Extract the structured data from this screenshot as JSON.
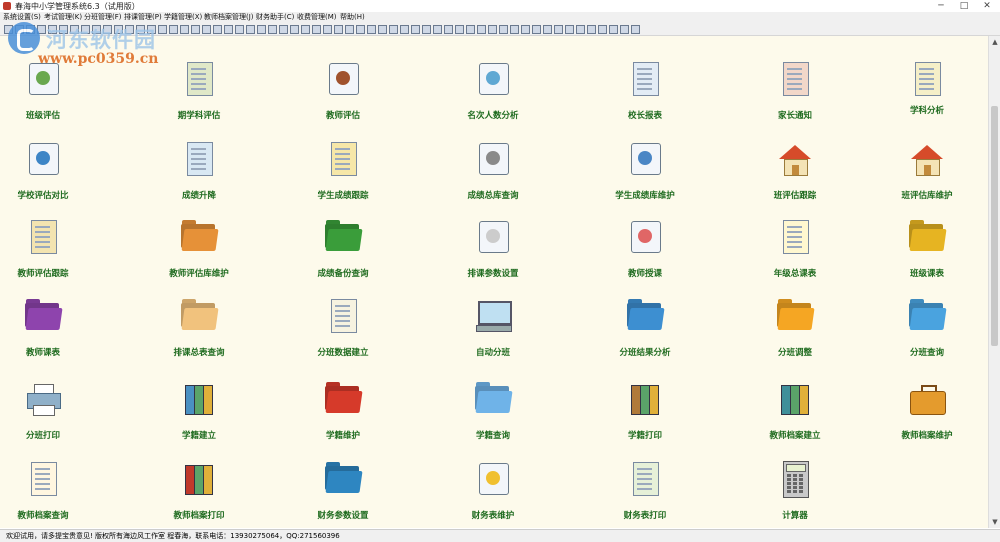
{
  "window": {
    "title": "春海中小学管理系统6.3（试用版）",
    "minimize": "─",
    "maximize": "□",
    "close": "✕"
  },
  "menu": [
    "系统设置(S)",
    "考试管理(K)",
    "分班管理(F)",
    "排课管理(P)",
    "学籍管理(X)",
    "教师档案管理(J)",
    "财务助手(C)",
    "收费管理(M)",
    "帮助(H)"
  ],
  "watermark": {
    "name": "河东软件园",
    "url": "www.pc0359.cn"
  },
  "tiles": [
    {
      "label": "班级评估",
      "icon": "bar-chart-icon",
      "kind": "generic",
      "color": "#6aa84f"
    },
    {
      "label": "期学科评估",
      "icon": "calendar-icon",
      "kind": "doc",
      "color": "#e0e8c8"
    },
    {
      "label": "教师评估",
      "icon": "teacher-photo-icon",
      "kind": "generic",
      "color": "#a0522d"
    },
    {
      "label": "名次人数分析",
      "icon": "open-book-icon",
      "kind": "generic",
      "color": "#5fa8d3"
    },
    {
      "label": "校长报表",
      "icon": "checklist-icon",
      "kind": "doc",
      "color": "#e3ecf5"
    },
    {
      "label": "家长通知",
      "icon": "ribbon-letter-icon",
      "kind": "doc",
      "color": "#f2d7c9"
    },
    {
      "label": "学科分析",
      "icon": "pencil-calendar-icon",
      "kind": "doc",
      "color": "#f5efc8"
    },
    {
      "label": "学校评估对比",
      "icon": "chart-compare-icon",
      "kind": "generic",
      "color": "#3d85c6"
    },
    {
      "label": "成绩升降",
      "icon": "clock-document-icon",
      "kind": "doc",
      "color": "#d9e8f3"
    },
    {
      "label": "学生成绩跟踪",
      "icon": "notepad-icon",
      "kind": "doc",
      "color": "#f6e7a8"
    },
    {
      "label": "成绩总库查询",
      "icon": "clock-calendar-icon",
      "kind": "generic",
      "color": "#8a8a8a"
    },
    {
      "label": "学生成绩库维护",
      "icon": "tile-windows-icon",
      "kind": "generic",
      "color": "#4a86c5"
    },
    {
      "label": "班评估跟踪",
      "icon": "house-icon",
      "kind": "house",
      "color": "#d64b2a"
    },
    {
      "label": "班评估库维护",
      "icon": "house-arrow-icon",
      "kind": "house",
      "color": "#d64b2a"
    },
    {
      "label": "教师评估跟踪",
      "icon": "document-arrow-icon",
      "kind": "doc",
      "color": "#f3e4b0"
    },
    {
      "label": "教师评估库维护",
      "icon": "orange-folder-icon",
      "kind": "folder",
      "color": "#e69138"
    },
    {
      "label": "成绩备份查询",
      "icon": "green-folder-icon",
      "kind": "folder",
      "color": "#3a9d3a"
    },
    {
      "label": "排课参数设置",
      "icon": "tablet-pen-icon",
      "kind": "generic",
      "color": "#cccccc"
    },
    {
      "label": "教师授课",
      "icon": "star-person-icon",
      "kind": "generic",
      "color": "#e06666"
    },
    {
      "label": "年级总课表",
      "icon": "notepad-lines-icon",
      "kind": "doc",
      "color": "#fff8d0"
    },
    {
      "label": "班级课表",
      "icon": "folder-binder-icon",
      "kind": "folder",
      "color": "#e6b422"
    },
    {
      "label": "教师课表",
      "icon": "purple-folder-icon",
      "kind": "folder",
      "color": "#8e44ad"
    },
    {
      "label": "排课总表查询",
      "icon": "open-folder-icon",
      "kind": "folder",
      "color": "#f1c27d"
    },
    {
      "label": "分班数据建立",
      "icon": "clipboard-person-icon",
      "kind": "doc",
      "color": "#f6f2e0"
    },
    {
      "label": "自动分班",
      "icon": "computer-icon",
      "kind": "monitor",
      "color": "#bfe0f2"
    },
    {
      "label": "分班结果分析",
      "icon": "blue-folder-disc-icon",
      "kind": "folder",
      "color": "#3d8fd1"
    },
    {
      "label": "分班调整",
      "icon": "yellow-folder-icon",
      "kind": "folder",
      "color": "#f5a623"
    },
    {
      "label": "分班查询",
      "icon": "blue-folder-icon",
      "kind": "folder",
      "color": "#4aa3df"
    },
    {
      "label": "分班打印",
      "icon": "printer-icon",
      "kind": "printer",
      "color": "#8fb0c9"
    },
    {
      "label": "学籍建立",
      "icon": "colored-binders-icon",
      "kind": "book",
      "color": "#4a90c2"
    },
    {
      "label": "学籍维护",
      "icon": "red-folder-icon",
      "kind": "folder",
      "color": "#d63a2a"
    },
    {
      "label": "学籍查询",
      "icon": "light-blue-folder-icon",
      "kind": "folder",
      "color": "#6fb3e8"
    },
    {
      "label": "学籍打印",
      "icon": "brown-binder-icon",
      "kind": "book",
      "color": "#b07a3a"
    },
    {
      "label": "教师档案建立",
      "icon": "teal-book-icon",
      "kind": "book",
      "color": "#3f8f9a"
    },
    {
      "label": "教师档案维护",
      "icon": "briefcase-icon",
      "kind": "case",
      "color": "#e49b2d"
    },
    {
      "label": "教师档案查询",
      "icon": "notepad-stack-icon",
      "kind": "doc",
      "color": "#fff6e0"
    },
    {
      "label": "教师档案打印",
      "icon": "book-stack-icon",
      "kind": "book",
      "color": "#c0392b"
    },
    {
      "label": "财务参数设置",
      "icon": "blue-folder-stack-icon",
      "kind": "folder",
      "color": "#2e86c1"
    },
    {
      "label": "财务表维护",
      "icon": "pen-cup-icon",
      "kind": "generic",
      "color": "#f0c030"
    },
    {
      "label": "财务表打印",
      "icon": "document-recycle-icon",
      "kind": "doc",
      "color": "#e6f0d8"
    },
    {
      "label": "计算器",
      "icon": "calculator-icon",
      "kind": "calc",
      "color": "#c9c9c9"
    }
  ],
  "status": "欢迎试用，请多提宝贵意见!  版权所有海边风工作室 程春海，联系电话：13930275064，QQ:271560396"
}
